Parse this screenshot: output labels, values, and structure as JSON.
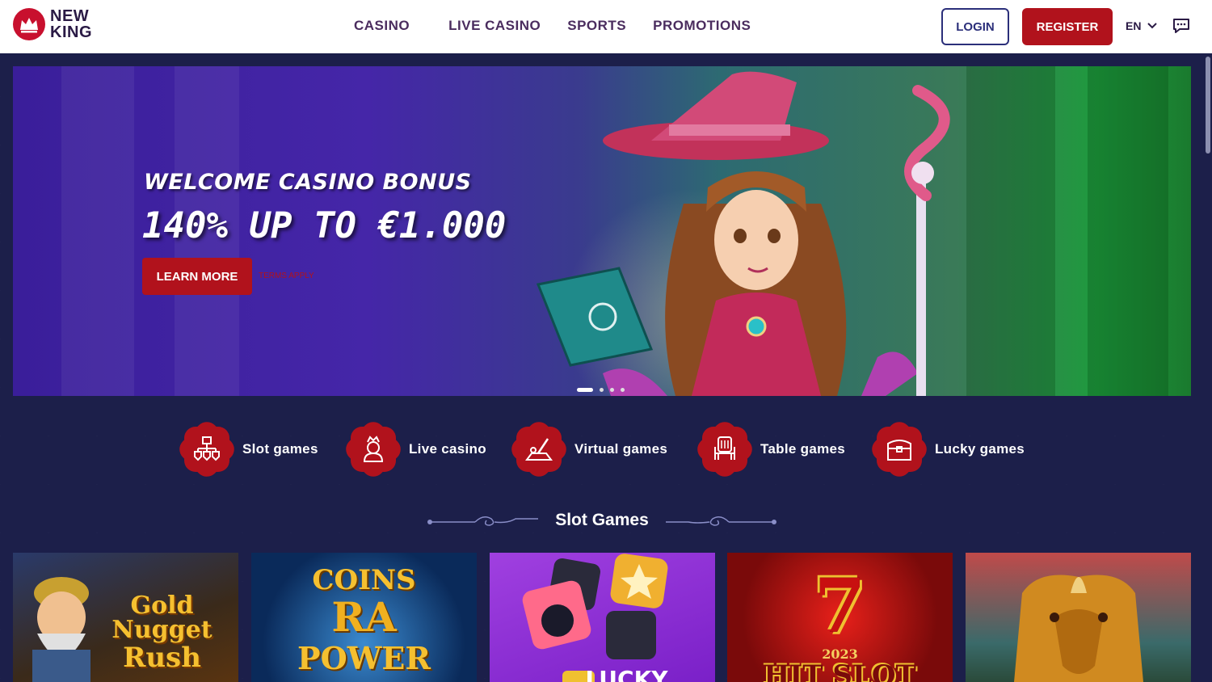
{
  "brand": {
    "line1": "NEW",
    "line2": "KING"
  },
  "nav": [
    "CASINO",
    "LIVE CASINO",
    "SPORTS",
    "PROMOTIONS"
  ],
  "header": {
    "login": "LOGIN",
    "register": "REGISTER",
    "language": "EN"
  },
  "hero": {
    "title": "WELCOME CASINO BONUS",
    "amount": "140% UP TO €1.000",
    "cta": "LEARN MORE",
    "terms": "TERMS APPLY",
    "slides": 4,
    "active_slide": 1
  },
  "categories": [
    {
      "label": "Slot games",
      "icon": "slot-games-icon"
    },
    {
      "label": "Live casino",
      "icon": "live-casino-icon"
    },
    {
      "label": "Virtual games",
      "icon": "virtual-games-icon"
    },
    {
      "label": "Table games",
      "icon": "table-games-icon"
    },
    {
      "label": "Lucky games",
      "icon": "lucky-games-icon"
    }
  ],
  "section": {
    "title": "Slot Games"
  },
  "games": [
    {
      "name": "Gold Nugget Rush",
      "line1": "Gold",
      "line2": "Nugget",
      "line3": "Rush"
    },
    {
      "name": "Coins of Ra Power",
      "line1": "COINS",
      "line2": "RA",
      "line3": "POWER"
    },
    {
      "name": "Lucky",
      "line1": "LUCKY"
    },
    {
      "name": "2023 Hit Slot",
      "line1": "7",
      "line2": "2023",
      "line3": "HIT SLOT"
    },
    {
      "name": "Rhino"
    }
  ],
  "colors": {
    "accent": "#b1121c",
    "background": "#1c1f4a",
    "nav_text": "#4a2c5e"
  }
}
